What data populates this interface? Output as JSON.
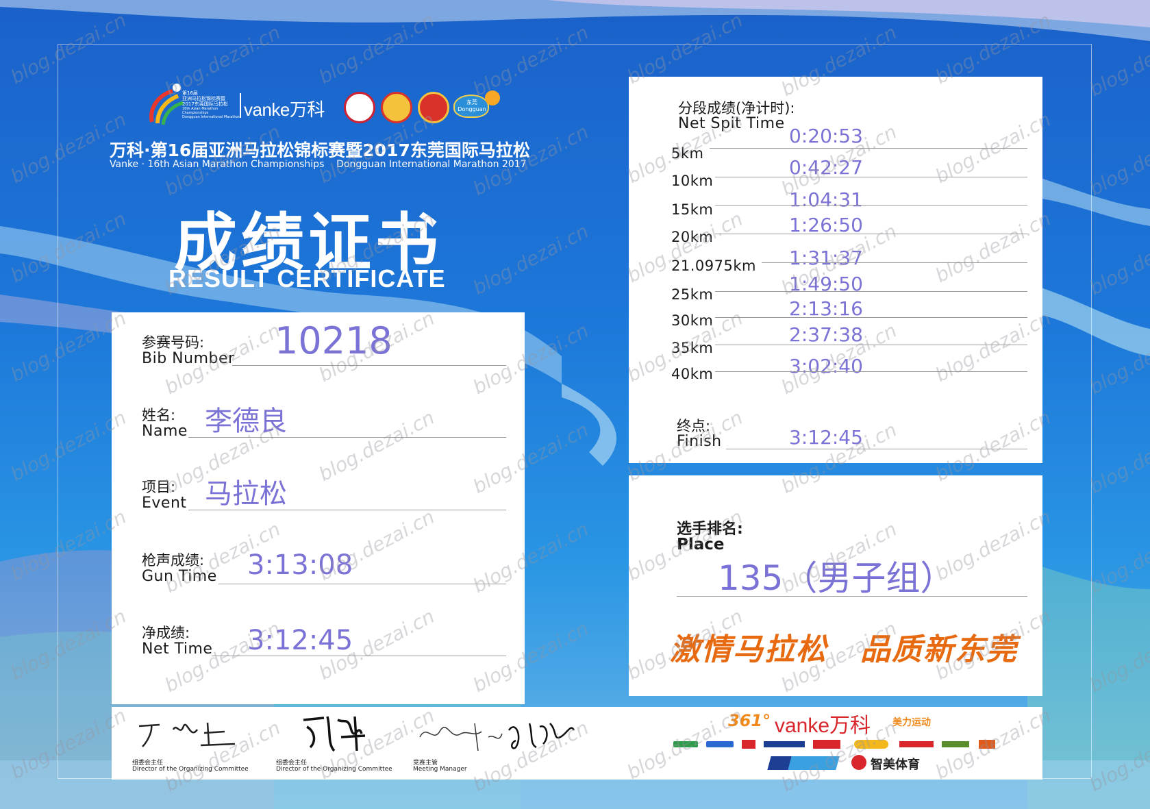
{
  "header": {
    "event_logo_lines": [
      "第16届",
      "亚洲马拉松锦标赛暨",
      "2017东莞国际马拉松",
      "16th Asian Marathon Championships",
      "Dongguan International Marathon"
    ],
    "sponsor_logo": "vanke万科",
    "partner_logo_text": "东莞 Dongguan",
    "title_cn": "万科·第16届亚洲马拉松锦标赛暨2017东莞国际马拉松",
    "title_en": "Vanke · 16th Asian Marathon Championships    Dongguan International Marathon 2017",
    "cert_cn": "成绩证书",
    "cert_en": "RESULT CERTIFICATE"
  },
  "info": {
    "bib": {
      "cn": "参赛号码:",
      "en": "Bib Number",
      "value": "10218"
    },
    "name": {
      "cn": "姓名:",
      "en": "Name",
      "value": "李德良"
    },
    "event": {
      "cn": "项目:",
      "en": "Event",
      "value": "马拉松"
    },
    "gun": {
      "cn": "枪声成绩:",
      "en": "Gun Time",
      "value": "3:13:08"
    },
    "net": {
      "cn": "净成绩:",
      "en": "Net Time",
      "value": "3:12:45"
    }
  },
  "splits": {
    "title_cn": "分段成绩(净计时):",
    "title_en": "Net Spit Time",
    "rows": [
      {
        "label": "5km",
        "value": "0:20:53"
      },
      {
        "label": "10km",
        "value": "0:42:27"
      },
      {
        "label": "15km",
        "value": "1:04:31"
      },
      {
        "label": "20km",
        "value": "1:26:50"
      },
      {
        "label": "21.0975km",
        "value": "1:31:37"
      },
      {
        "label": "25km",
        "value": "1:49:50"
      },
      {
        "label": "30km",
        "value": "2:13:16"
      },
      {
        "label": "35km",
        "value": "2:37:38"
      },
      {
        "label": "40km",
        "value": "3:02:40"
      }
    ],
    "finish_cn": "终点:",
    "finish_en": "Finish",
    "finish_value": "3:12:45"
  },
  "place": {
    "cn": "选手排名:",
    "en": "Place",
    "value": "135（男子组）",
    "slogan_left": "激情马拉松",
    "slogan_right": "品质新东莞"
  },
  "signatures": [
    {
      "role_cn": "组委会主任",
      "role_en": "Director of the Organizing Committee"
    },
    {
      "role_cn": "组委会主任",
      "role_en": "Director of the Organizing Committee"
    },
    {
      "role_cn": "竞赛主管",
      "role_en": "Meeting Manager"
    }
  ],
  "sponsors": {
    "brand_361": "361°",
    "brand_vanke": "vanke万科",
    "slogan": "美力运动",
    "zhimei": "智美体育"
  },
  "watermark": "blog.dezai.cn",
  "colors": {
    "value_text": "#7b72d6",
    "slogan_orange": "#e86a10",
    "background_blue": "#1d78d9"
  }
}
